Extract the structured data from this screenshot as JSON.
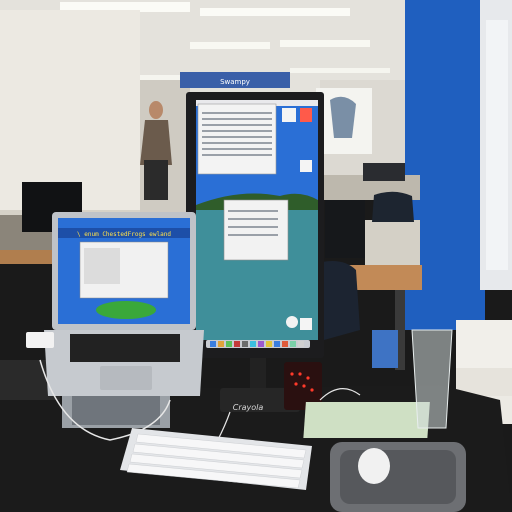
{
  "scene": {
    "laptop_screen_banner": "\\ enum ChestedFrogs ewland",
    "monitor_brand": "Crayola",
    "wall_sign": "Swampy"
  },
  "colors": {
    "blue_wall": "#1f5fbf",
    "ceiling": "#e8e6e0",
    "desk": "#1b1b1b",
    "screen_blue": "#2a6fd6",
    "water": "#3f8f9a"
  }
}
